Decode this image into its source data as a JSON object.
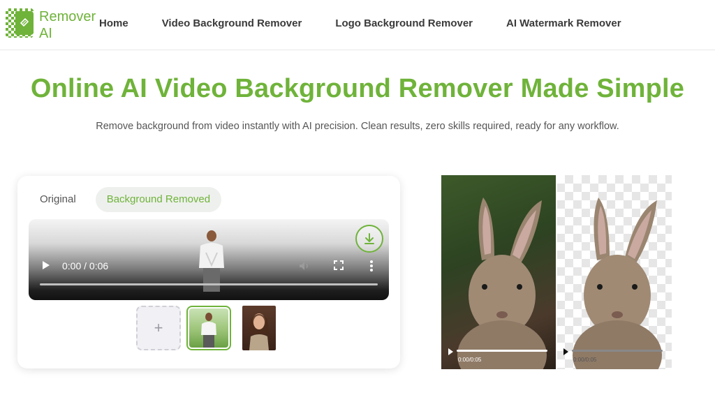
{
  "brand": {
    "line1": "Remover",
    "line2": "AI",
    "accent": "#6fb33a"
  },
  "nav": {
    "items": [
      "Home",
      "Video Background Remover",
      "Logo Background Remover",
      "AI Watermark Remover"
    ]
  },
  "hero": {
    "title": "Online AI Video Background Remover Made Simple",
    "subtitle": "Remove background from video instantly with AI precision. Clean results, zero skills required, ready for any workflow."
  },
  "editor": {
    "tabs": [
      "Original",
      "Background Removed"
    ],
    "active_tab": "Background Removed",
    "player": {
      "time": "0:00 / 0:06",
      "icons": [
        "download-icon",
        "play-icon",
        "volume-icon",
        "fullscreen-icon",
        "more-icon"
      ]
    },
    "add_label": "+",
    "thumbnails": [
      "golfer-thumbnail",
      "woman-thumbnail"
    ]
  },
  "preview": {
    "left_time": "0:00/0:05",
    "right_time": "0:00/0:05"
  }
}
